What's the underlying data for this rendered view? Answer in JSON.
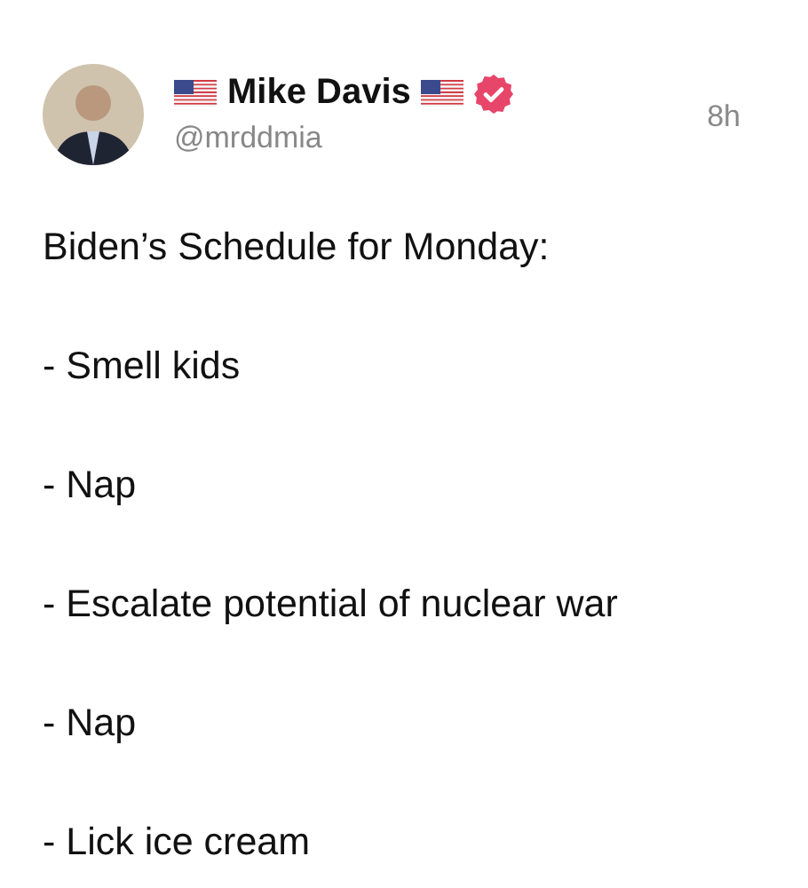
{
  "post": {
    "author": {
      "name": "Mike Davis",
      "handle": "@mrddmia",
      "verified": true
    },
    "time": "8h",
    "lines": [
      "Biden’s Schedule for Monday:",
      "- Smell kids",
      "- Nap",
      "- Escalate potential of nuclear war",
      "- Nap",
      "- Lick ice cream"
    ]
  }
}
